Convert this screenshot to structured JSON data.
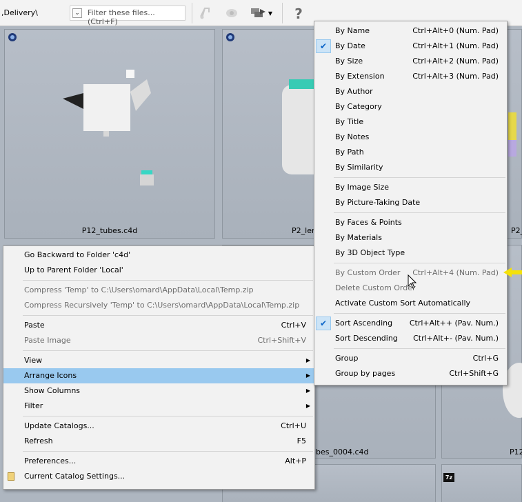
{
  "toolbar": {
    "path": ",Delivery\\",
    "filter_placeholder": "Filter these files... (Ctrl+F)",
    "icons": [
      "sound-icon",
      "eye-icon",
      "arrange-icon",
      "help-icon"
    ]
  },
  "tiles": [
    {
      "label": "P12_tubes.c4d"
    },
    {
      "label": "P2_ler"
    },
    {
      "label": "P2_"
    },
    {
      "label": "ubes_0004.c4d"
    },
    {
      "label": "P12"
    }
  ],
  "context_menu": {
    "items": [
      {
        "label": "Go Backward to Folder 'c4d'",
        "shortcut": ""
      },
      {
        "label": "Up to Parent Folder 'Local'",
        "shortcut": ""
      },
      {
        "label": "Compress 'Temp' to C:\\Users\\omard\\AppData\\Local\\Temp.zip",
        "shortcut": ""
      },
      {
        "label": "Compress Recursively 'Temp' to C:\\Users\\omard\\AppData\\Local\\Temp.zip",
        "shortcut": ""
      },
      {
        "label": "Paste",
        "shortcut": "Ctrl+V"
      },
      {
        "label": "Paste Image",
        "shortcut": "Ctrl+Shift+V"
      },
      {
        "label": "View",
        "shortcut": ""
      },
      {
        "label": "Arrange Icons",
        "shortcut": ""
      },
      {
        "label": "Show Columns",
        "shortcut": ""
      },
      {
        "label": "Filter",
        "shortcut": ""
      },
      {
        "label": "Update Catalogs...",
        "shortcut": "Ctrl+U"
      },
      {
        "label": "Refresh",
        "shortcut": "F5"
      },
      {
        "label": "Preferences...",
        "shortcut": "Alt+P"
      },
      {
        "label": "Current Catalog Settings...",
        "shortcut": ""
      }
    ]
  },
  "submenu": {
    "items": [
      {
        "label": "By Name",
        "shortcut": "Ctrl+Alt+0 (Num. Pad)"
      },
      {
        "label": "By Date",
        "shortcut": "Ctrl+Alt+1 (Num. Pad)"
      },
      {
        "label": "By Size",
        "shortcut": "Ctrl+Alt+2 (Num. Pad)"
      },
      {
        "label": "By Extension",
        "shortcut": "Ctrl+Alt+3 (Num. Pad)"
      },
      {
        "label": "By Author",
        "shortcut": ""
      },
      {
        "label": "By Category",
        "shortcut": ""
      },
      {
        "label": "By Title",
        "shortcut": ""
      },
      {
        "label": "By Notes",
        "shortcut": ""
      },
      {
        "label": "By Path",
        "shortcut": ""
      },
      {
        "label": "By Similarity",
        "shortcut": ""
      },
      {
        "label": "By Image Size",
        "shortcut": ""
      },
      {
        "label": "By Picture-Taking Date",
        "shortcut": ""
      },
      {
        "label": "By Faces & Points",
        "shortcut": ""
      },
      {
        "label": "By Materials",
        "shortcut": ""
      },
      {
        "label": "By 3D Object Type",
        "shortcut": ""
      },
      {
        "label": "By Custom Order",
        "shortcut": "Ctrl+Alt+4 (Num. Pad)"
      },
      {
        "label": "Delete Custom Order",
        "shortcut": ""
      },
      {
        "label": "Activate Custom Sort Automatically",
        "shortcut": ""
      },
      {
        "label": "Sort Ascending",
        "shortcut": "Ctrl+Alt++ (Pav. Num.)"
      },
      {
        "label": "Sort Descending",
        "shortcut": "Ctrl+Alt+- (Pav. Num.)"
      },
      {
        "label": "Group",
        "shortcut": "Ctrl+G"
      },
      {
        "label": "Group by pages",
        "shortcut": "Ctrl+Shift+G"
      }
    ]
  },
  "colors": {
    "highlight": "#99c9ef",
    "check": "#0a64c8",
    "arrow": "#f4e10a"
  }
}
